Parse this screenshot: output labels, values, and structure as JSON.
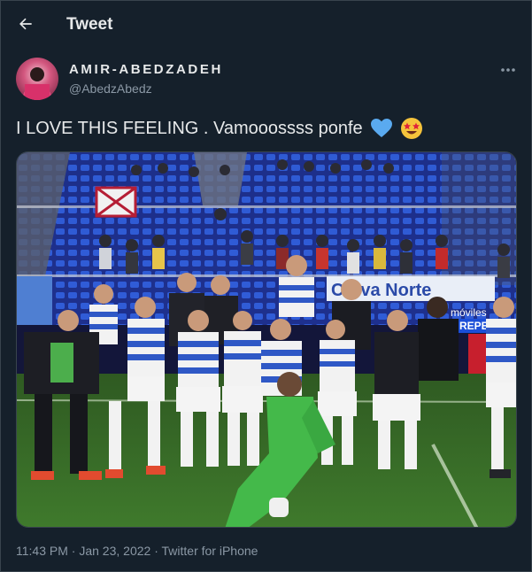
{
  "header": {
    "title": "Tweet",
    "back_icon": "arrow-left-icon"
  },
  "author": {
    "name": "AMIR-ABEDZADEH",
    "handle": "@AbedzAbedz",
    "more_icon": "more-horizontal-icon"
  },
  "tweet": {
    "text": "I LOVE THIS FEELING . Vamooossss ponfe",
    "emojis": [
      "blue-heart-icon",
      "star-struck-icon"
    ]
  },
  "media": {
    "banner_text": "Cerva Norte",
    "sponsor_text": "móviles",
    "sponsor_text_2": "REPE"
  },
  "meta": {
    "time": "11:43 PM",
    "separator": "·",
    "date": "Jan 23, 2022",
    "source": "Twitter for iPhone"
  },
  "colors": {
    "background": "#15202b",
    "text_primary": "#e7e9ea",
    "text_secondary": "#8b98a5",
    "border": "#38444d",
    "heart": "#1d9bf0",
    "pitch": "#3f6b2e",
    "seats": "#2f54d6"
  }
}
